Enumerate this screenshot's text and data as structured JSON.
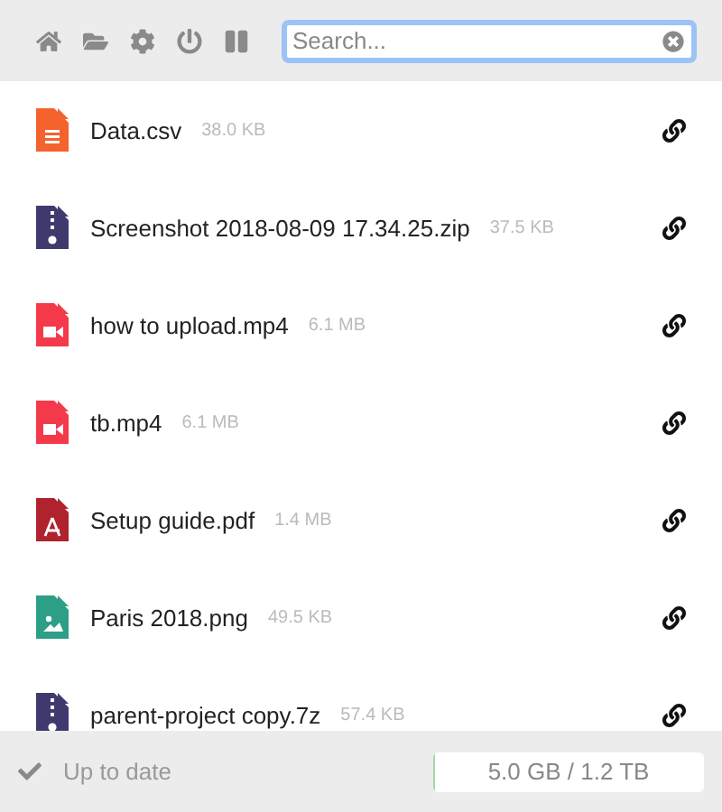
{
  "search": {
    "placeholder": "Search..."
  },
  "files": [
    {
      "name": "Data.csv",
      "size": "38.0 KB",
      "kind": "document"
    },
    {
      "name": "Screenshot 2018-08-09 17.34.25.zip",
      "size": "37.5 KB",
      "kind": "archive"
    },
    {
      "name": "how to upload.mp4",
      "size": "6.1 MB",
      "kind": "video"
    },
    {
      "name": "tb.mp4",
      "size": "6.1 MB",
      "kind": "video"
    },
    {
      "name": "Setup guide.pdf",
      "size": "1.4 MB",
      "kind": "pdf"
    },
    {
      "name": "Paris 2018.png",
      "size": "49.5 KB",
      "kind": "image"
    },
    {
      "name": "parent-project copy.7z",
      "size": "57.4 KB",
      "kind": "archive"
    }
  ],
  "status": {
    "text": "Up to date"
  },
  "storage": {
    "text": "5.0 GB / 1.2 TB",
    "level": 0.004
  }
}
